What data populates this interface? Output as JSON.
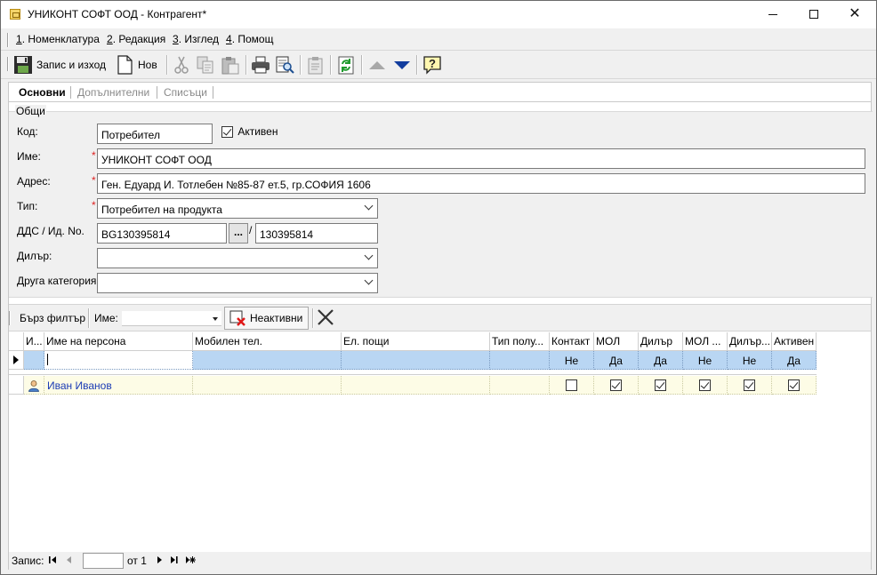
{
  "window": {
    "title": "УНИКОНТ СОФТ ООД - Контрагент*"
  },
  "menu": [
    {
      "key": "1",
      "rest": ". Номенклатура"
    },
    {
      "key": "2",
      "rest": ". Редакция"
    },
    {
      "key": "3",
      "rest": ". Изглед"
    },
    {
      "key": "4",
      "rest": ". Помощ"
    }
  ],
  "toolbar": {
    "save_exit_label": "Запис и изход",
    "new_label": "Нов"
  },
  "tabs": [
    "Основни",
    "Допълнителни",
    "Списъци"
  ],
  "group": {
    "legend": "Общи",
    "code_label": "Код:",
    "code_value": "Потребител",
    "active_label": "Активен",
    "active_checked": true,
    "name_label": "Име:",
    "name_value": "УНИКОНТ СОФТ ООД",
    "address_label": "Адрес:",
    "address_value": "Ген. Едуард И. Тотлебен  №85-87 ет.5, гр.СОФИЯ 1606",
    "type_label": "Тип:",
    "type_value": "Потребител на продукта",
    "vat_label": "ДДС / Ид. No.",
    "vat_value": "BG130395814",
    "vat_button": "...",
    "vat_separator": "/",
    "id_value": "130395814",
    "dealer_label": "Дилър:",
    "dealer_value": "",
    "category_label": "Друга категория",
    "category_value": "",
    "required_mark": "*"
  },
  "filterbar": {
    "quick_filter_label": "Бърз филтър",
    "name_label": "Име:",
    "name_value": "",
    "inactive_label": "Неактивни"
  },
  "grid": {
    "columns": [
      "И...",
      "Име на персона",
      "Мобилен тел.",
      "Ел. пощи",
      "Тип полу...",
      "Контакт",
      "МОЛ",
      "Дилър",
      "МОЛ ...",
      "Дилър...",
      "Активен"
    ],
    "filter_row": [
      "",
      "",
      "",
      "",
      "",
      "Не",
      "Да",
      "Да",
      "Не",
      "Не",
      "Да"
    ],
    "rows": [
      {
        "name": "Иван Иванов",
        "mobile": "",
        "email": "",
        "type": "",
        "contact": false,
        "mol": true,
        "dealer": true,
        "mol2": true,
        "dealer2": true,
        "active": true
      }
    ]
  },
  "navbar": {
    "record_label": "Запис:",
    "record_value": "",
    "of_label": "от 1"
  }
}
